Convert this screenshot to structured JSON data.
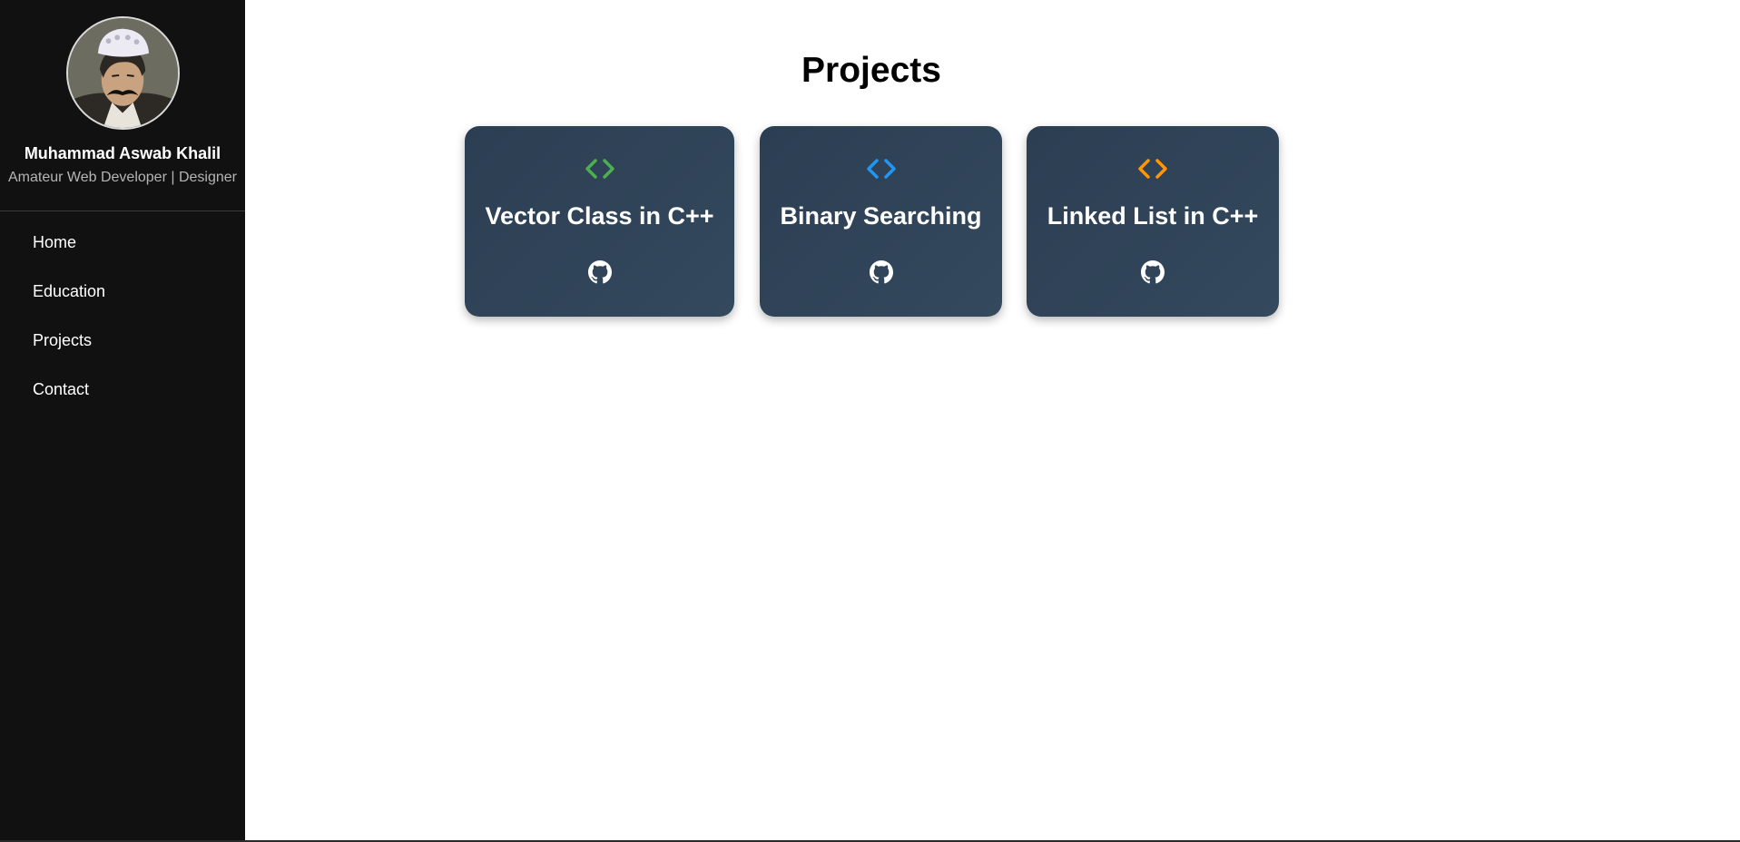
{
  "sidebar": {
    "profile": {
      "name": "Muhammad Aswab Khalil",
      "role": "Amateur Web Developer | Designer"
    },
    "nav": [
      {
        "label": "Home"
      },
      {
        "label": "Education"
      },
      {
        "label": "Projects"
      },
      {
        "label": "Contact"
      }
    ]
  },
  "main": {
    "title": "Projects",
    "projects": [
      {
        "title": "Vector Class in C++",
        "icon": "code-icon",
        "icon_color": "#4caf50",
        "link_icon": "github-icon"
      },
      {
        "title": "Binary Searching",
        "icon": "code-icon",
        "icon_color": "#2196f3",
        "link_icon": "github-icon"
      },
      {
        "title": "Linked List in C++",
        "icon": "code-icon",
        "icon_color": "#ff9800",
        "link_icon": "github-icon"
      }
    ]
  },
  "colors": {
    "sidebar_bg": "#111111",
    "card_bg": "#2f4358",
    "accent_green": "#4caf50",
    "accent_blue": "#2196f3",
    "accent_orange": "#ff9800"
  }
}
